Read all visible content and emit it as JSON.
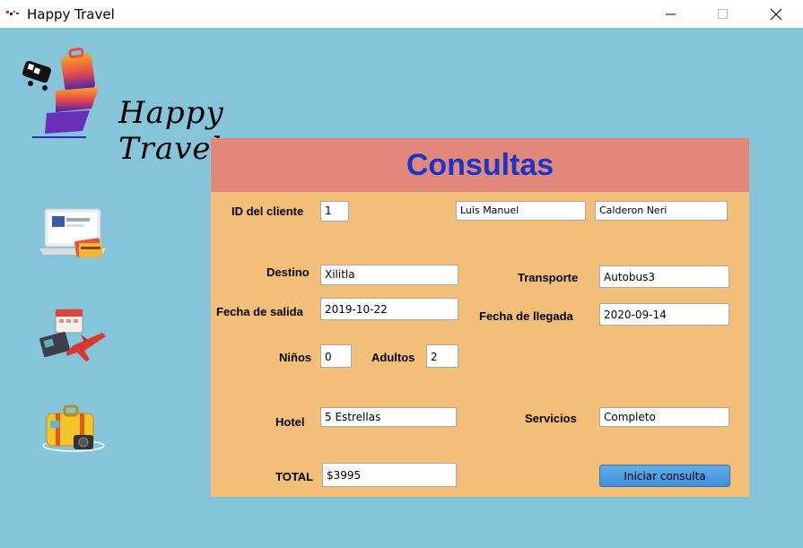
{
  "window": {
    "title": "Happy Travel",
    "controls": {
      "minimize": "minimize-icon",
      "maximize": "maximize-icon",
      "close": "close-icon"
    }
  },
  "logo": {
    "text": "Happy Travel"
  },
  "sidebar": {
    "icons": [
      "laptop-payment-icon",
      "travel-calendar-plane-icon",
      "suitcase-camera-icon"
    ]
  },
  "form": {
    "title": "Consultas",
    "labels": {
      "client_id": "ID del cliente",
      "destination": "Destino",
      "transport": "Transporte",
      "departure": "Fecha de salida",
      "arrival": "Fecha de llegada",
      "children": "Niños",
      "adults": "Adultos",
      "hotel": "Hotel",
      "services": "Servicios",
      "total": "TOTAL"
    },
    "values": {
      "client_id": "1",
      "first_name": "Luis Manuel",
      "last_name": "Calderon Neri",
      "destination": "Xilitla",
      "transport": "Autobus3",
      "departure": "2019-10-22",
      "arrival": "2020-09-14",
      "children": "0",
      "adults": "2",
      "hotel": "5 Estrellas",
      "services": "Completo",
      "total": "$3995"
    },
    "button_label": "Iniciar consulta"
  },
  "colors": {
    "background": "#85c4d9",
    "panel": "#f2be78",
    "header": "#e2887a",
    "title_text": "#1a35c8",
    "button": "#4a9ae0"
  }
}
